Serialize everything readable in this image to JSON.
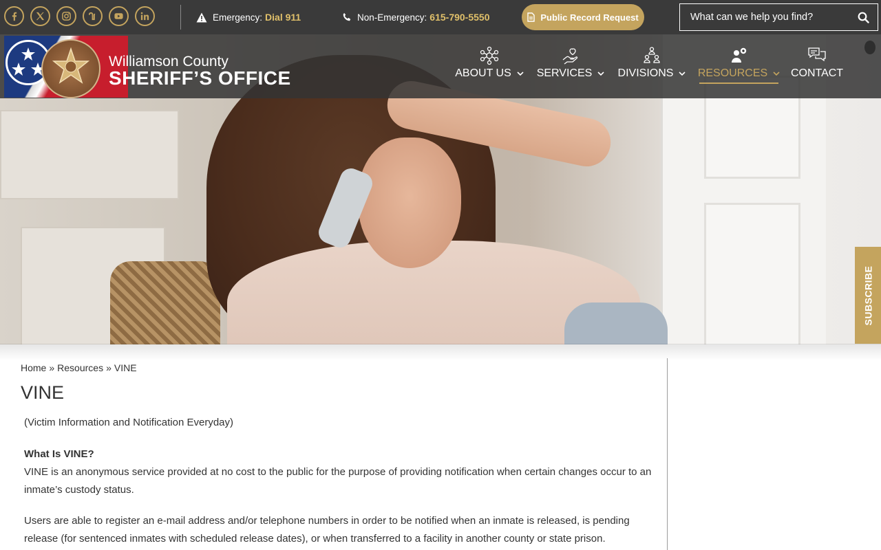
{
  "topbar": {
    "social": [
      {
        "name": "facebook-icon",
        "glyph": "f"
      },
      {
        "name": "x-twitter-icon",
        "glyph": "X"
      },
      {
        "name": "instagram-icon",
        "glyph": "ig"
      },
      {
        "name": "nextdoor-icon",
        "glyph": "n"
      },
      {
        "name": "youtube-icon",
        "glyph": "yt"
      },
      {
        "name": "linkedin-icon",
        "glyph": "in"
      }
    ],
    "emergency_label": "Emergency:",
    "emergency_value": "Dial 911",
    "nonemergency_label": "Non-Emergency:",
    "nonemergency_value": "615-790-5550",
    "public_record_button": "Public Record Request",
    "search_placeholder": "What can we help you find?"
  },
  "brand": {
    "line1": "Williamson County",
    "line2": "SHERIFF’S OFFICE"
  },
  "nav": {
    "items": [
      {
        "label": "ABOUT US",
        "icon": "network-icon",
        "has_dropdown": true
      },
      {
        "label": "SERVICES",
        "icon": "hand-heart-icon",
        "has_dropdown": true
      },
      {
        "label": "DIVISIONS",
        "icon": "people-group-icon",
        "has_dropdown": true
      },
      {
        "label": "RESOURCES",
        "icon": "user-gear-icon",
        "has_dropdown": true,
        "active": true
      },
      {
        "label": "CONTACT",
        "icon": "chat-bubbles-icon",
        "has_dropdown": false
      }
    ]
  },
  "subscribe_label": "SUBSCRIBE",
  "breadcrumb": {
    "home": "Home",
    "sep": "»",
    "resources": "Resources",
    "current": "VINE"
  },
  "page": {
    "title": "VINE",
    "subtitle": "(Victim Information and Notification Everyday)",
    "heading": "What Is VINE?",
    "para1": "VINE is an anonymous service provided at no cost to the public for the purpose of providing notification when certain changes occur to an inmate’s custody status.",
    "para2": "Users are able to register an e-mail address and/or telephone numbers in order to be notified when an inmate is released, is pending release (for sentenced inmates with scheduled release dates), or when transferred to a facility in another county or state prison."
  },
  "colors": {
    "accent_gold": "#c4a45e",
    "topbar_bg": "#3a3a3a",
    "text": "#333333"
  }
}
